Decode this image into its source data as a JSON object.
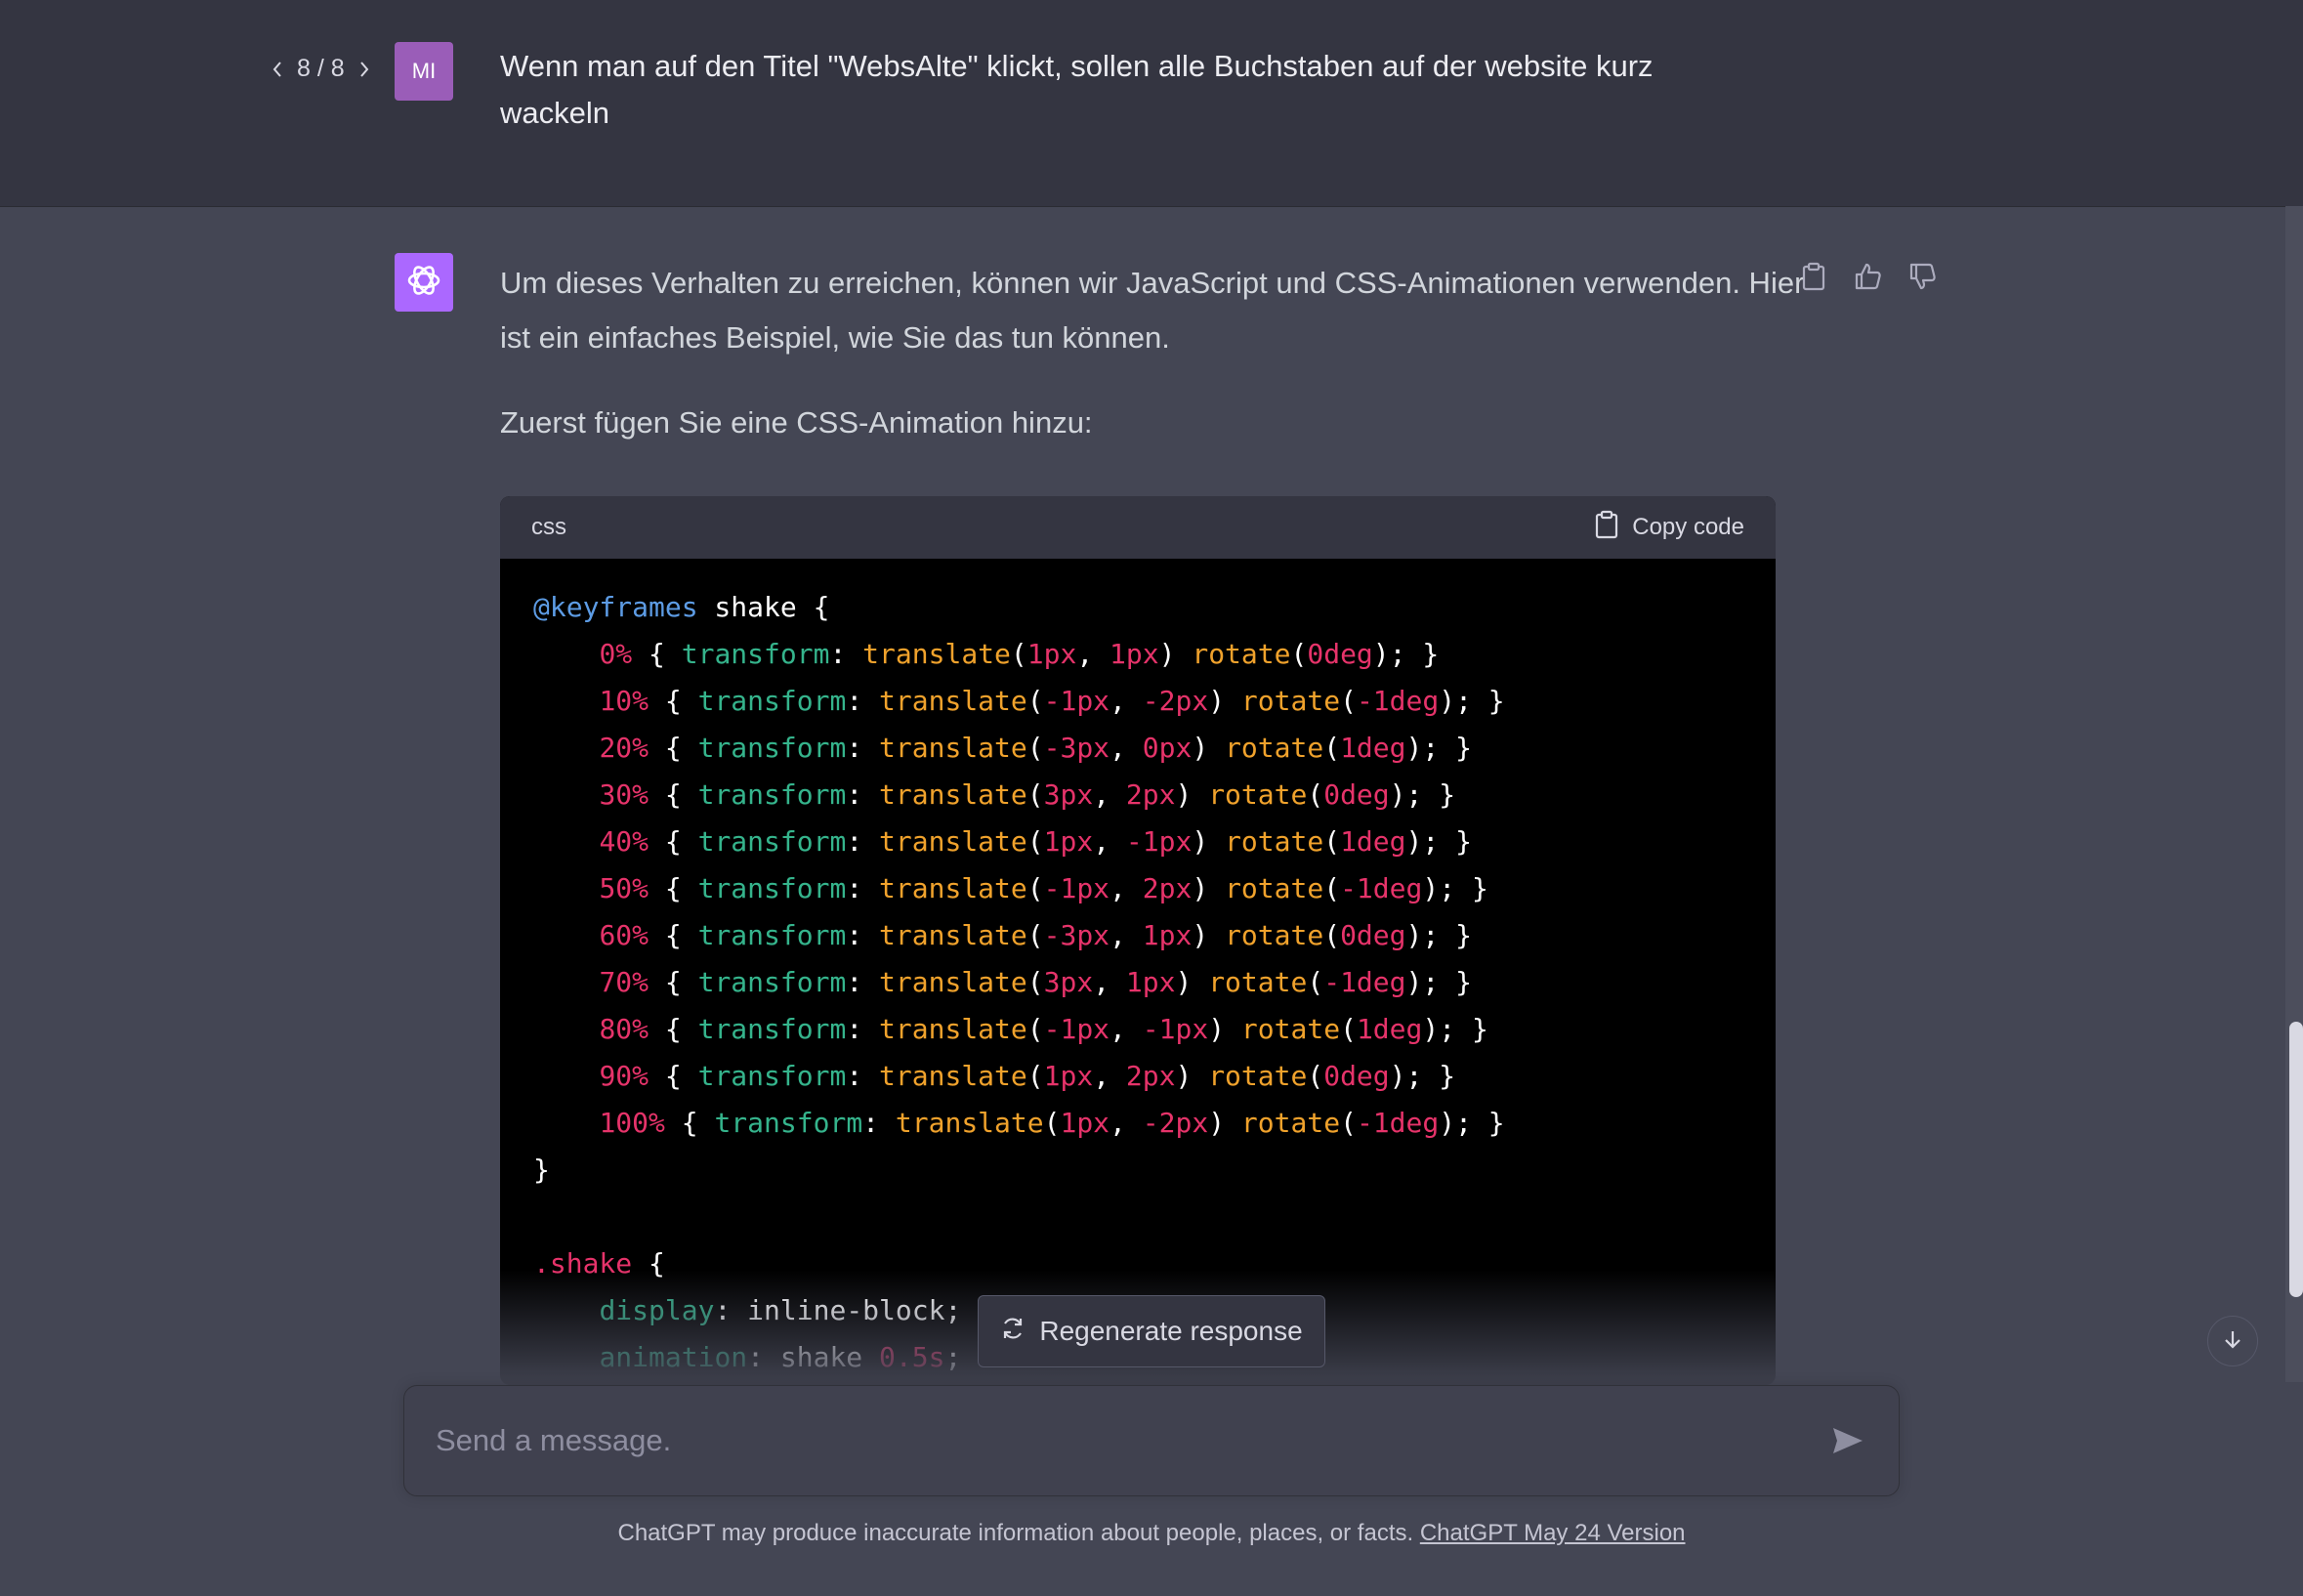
{
  "user_message": {
    "pager": "8 / 8",
    "avatar": "MI",
    "text": "Wenn man auf den Titel \"WebsAlte\" klickt, sollen alle Buchstaben auf der website kurz wackeln"
  },
  "assistant_message": {
    "para1": "Um dieses Verhalten zu erreichen, können wir JavaScript und CSS-Animationen verwenden. Hier ist ein einfaches Beispiel, wie Sie das tun können.",
    "para2": "Zuerst fügen Sie eine CSS-Animation hinzu:",
    "code_language": "css",
    "copy_label": "Copy code"
  },
  "code": {
    "kf_at": "@keyframes",
    "kf_name": " shake {",
    "lines": [
      {
        "pct": "0%",
        "tx": "1px",
        "ty": "1px",
        "rot": "0deg"
      },
      {
        "pct": "10%",
        "tx": "-1px",
        "ty": "-2px",
        "rot": "-1deg"
      },
      {
        "pct": "20%",
        "tx": "-3px",
        "ty": "0px",
        "rot": "1deg"
      },
      {
        "pct": "30%",
        "tx": "3px",
        "ty": "2px",
        "rot": "0deg"
      },
      {
        "pct": "40%",
        "tx": "1px",
        "ty": "-1px",
        "rot": "1deg"
      },
      {
        "pct": "50%",
        "tx": "-1px",
        "ty": "2px",
        "rot": "-1deg"
      },
      {
        "pct": "60%",
        "tx": "-3px",
        "ty": "1px",
        "rot": "0deg"
      },
      {
        "pct": "70%",
        "tx": "3px",
        "ty": "1px",
        "rot": "-1deg"
      },
      {
        "pct": "80%",
        "tx": "-1px",
        "ty": "-1px",
        "rot": "1deg"
      },
      {
        "pct": "90%",
        "tx": "1px",
        "ty": "2px",
        "rot": "0deg"
      },
      {
        "pct": "100%",
        "tx": "1px",
        "ty": "-2px",
        "rot": "-1deg"
      }
    ],
    "close": "}",
    "sel": ".shake",
    "sel_open": " {",
    "display_prop": "display",
    "display_val": ": inline-block;",
    "anim_prop": "animation",
    "anim_name": ": shake ",
    "anim_dur": "0.5s",
    "anim_end": ";"
  },
  "regenerate_label": "Regenerate response",
  "composer": {
    "placeholder": "Send a message."
  },
  "footer": {
    "text": "ChatGPT may produce inaccurate information about people, places, or facts. ",
    "link": "ChatGPT May 24 Version"
  },
  "colors": {
    "bg_user": "#343541",
    "bg_assistant": "#444654",
    "avatar_user": "#9a5db8",
    "avatar_bot": "#ab68ff"
  },
  "icons": [
    "chevron-left-icon",
    "chevron-right-icon",
    "openai-logo-icon",
    "clipboard-icon",
    "thumbs-up-icon",
    "thumbs-down-icon",
    "refresh-icon",
    "arrow-down-icon",
    "send-icon"
  ]
}
